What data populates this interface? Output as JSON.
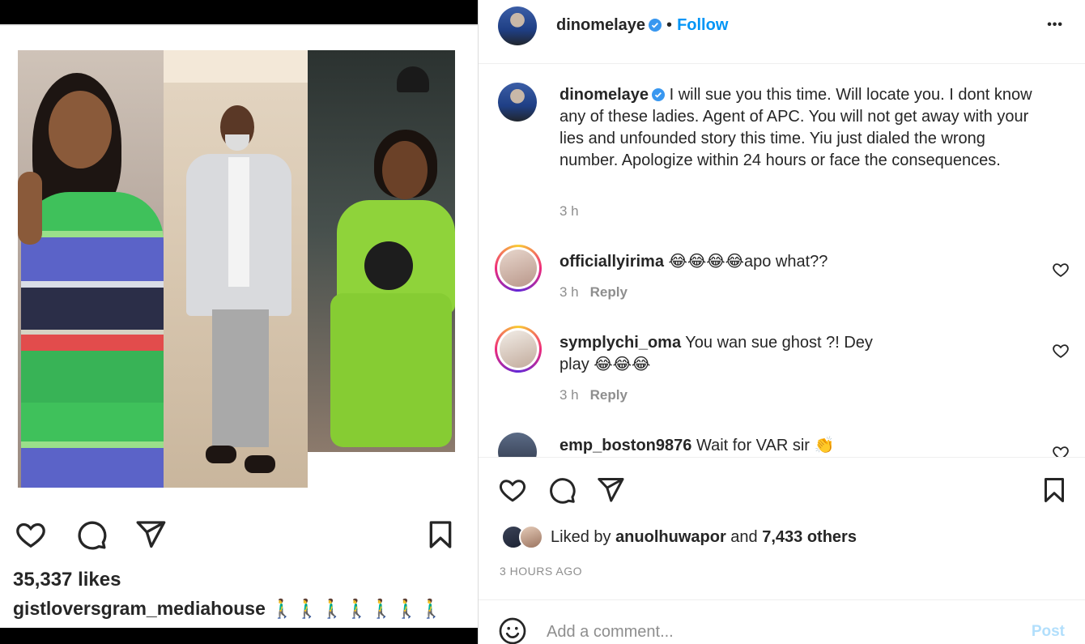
{
  "left": {
    "likes": "35,337 likes",
    "caption_user": "gistloversgram_mediahouse",
    "caption_emoji": "🚶‍♂️🚶‍♂️🚶‍♂️🚶‍♂️🚶‍♂️🚶‍♂️🚶‍♂️"
  },
  "header": {
    "username": "dinomelaye",
    "separator": "•",
    "follow": "Follow",
    "more": "•••"
  },
  "caption": {
    "username": "dinomelaye",
    "text": "I will sue you this time. Will locate you. I dont know any of these ladies. Agent of APC. You will not get away with your lies and unfounded story this time. Yiu just dialed the wrong number. Apologize within 24 hours or face the consequences.",
    "time": "3 h"
  },
  "comments": [
    {
      "username": "officiallyirima",
      "text": "😂😂😂😂apo what??",
      "time": "3 h",
      "reply": "Reply"
    },
    {
      "username": "symplychi_oma",
      "text": "You wan sue ghost ?! Dey play 😂😂😂",
      "time": "3 h",
      "reply": "Reply"
    },
    {
      "username": "emp_boston9876",
      "text": "Wait for VAR sir 👏",
      "time": "",
      "reply": ""
    }
  ],
  "likes": {
    "prefix": "Liked by ",
    "user": "anuolhuwapor",
    "middle": " and ",
    "others": "7,433 others"
  },
  "time_ago": "3 HOURS AGO",
  "add_comment": {
    "placeholder": "Add a comment...",
    "post": "Post"
  },
  "colors": {
    "accent": "#0095f6",
    "post_disabled": "#b2dffc",
    "muted": "#8e8e8e",
    "text": "#262626"
  }
}
